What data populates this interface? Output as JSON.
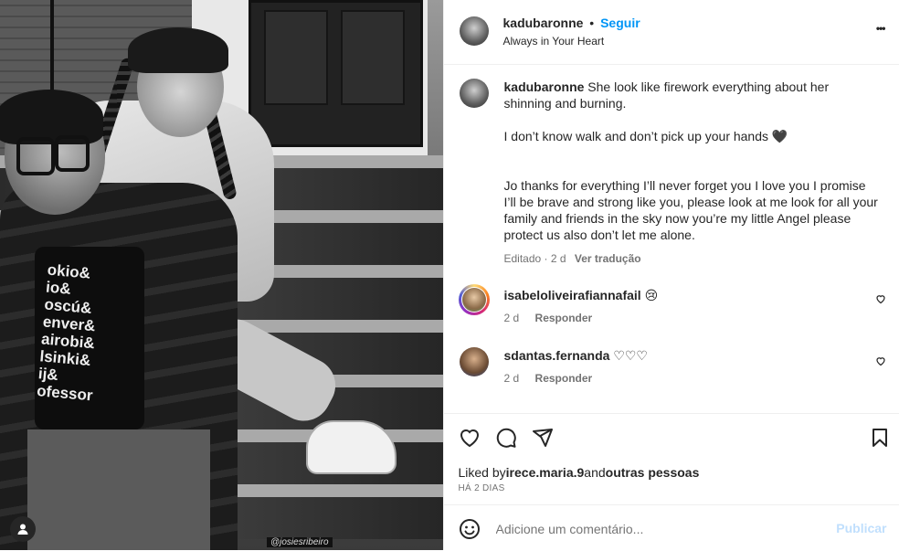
{
  "post": {
    "username": "kadubaronne",
    "follow_label": "Seguir",
    "separator": "•",
    "location": "Always in Your Heart",
    "more_label": "•••"
  },
  "photo": {
    "watermark": "@josiesribeiro",
    "shirt_lines": [
      "okio&",
      "io&",
      "oscú&",
      "enver&",
      "airobi&",
      "lsinki&",
      "ij&",
      "ofessor"
    ]
  },
  "caption": {
    "username": "kadubaronne",
    "text1": "She look like firework everything about her shinning and burning.",
    "text2": "I don’t know walk and don’t pick up your hands",
    "emoji2": "🖤",
    "text3": "Jo thanks for everything I’ll never forget you I love you I promise I’ll be brave and strong like you, please look at me look for all your family and friends in the sky now you’re my little Angel please protect us also don’t let me alone.",
    "edited": "Editado · 2 d",
    "translate": "Ver tradução"
  },
  "comments": [
    {
      "username": "isabeloliveirafiannafail",
      "text": "😢",
      "time": "2 d",
      "reply": "Responder"
    },
    {
      "username": "sdantas.fernanda",
      "text": "♡♡♡",
      "time": "2 d",
      "reply": "Responder"
    }
  ],
  "likes": {
    "prefix": "Liked by",
    "user": "irece.maria.9",
    "and": "and",
    "others": "outras pessoas",
    "time": "HÁ 2 DIAS"
  },
  "add_comment": {
    "placeholder": "Adicione um comentário...",
    "publish": "Publicar"
  },
  "colors": {
    "accent": "#0095f6",
    "text": "#262626",
    "muted": "#737373",
    "publish_disabled": "#c0dffd"
  }
}
